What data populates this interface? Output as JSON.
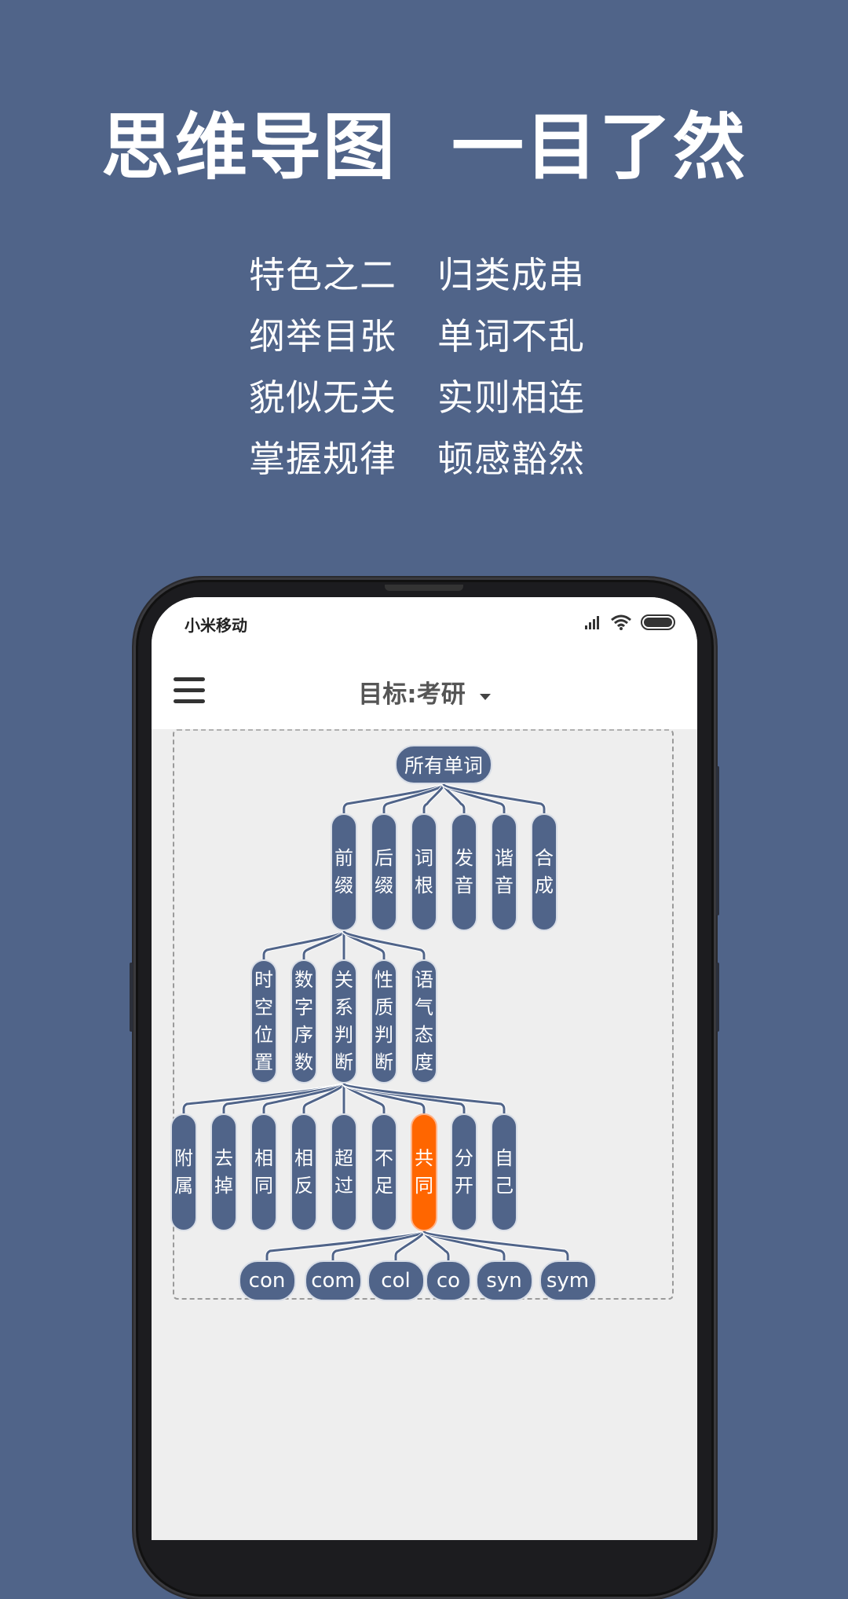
{
  "headline": {
    "part1": "思维导图",
    "part2": "一目了然"
  },
  "taglines": {
    "left": [
      "特色之二",
      "纲举目张",
      "貌似无关",
      "掌握规律"
    ],
    "right": [
      "归类成串",
      "单词不乱",
      "实则相连",
      "顿感豁然"
    ]
  },
  "status_bar": {
    "carrier": "小米移动",
    "icons": [
      "signal-icon",
      "wifi-icon",
      "battery-icon"
    ]
  },
  "app_bar": {
    "menu_icon": "hamburger-menu-icon",
    "title": "目标:考研",
    "dropdown_icon": "caret-down-icon"
  },
  "colors": {
    "background": "#506489",
    "node": "#506489",
    "node_active": "#ff6600",
    "canvas": "#eeeeee"
  },
  "mind_map": {
    "root": "所有单词",
    "level1": [
      "前缀",
      "后缀",
      "词根",
      "发音",
      "谐音",
      "合成"
    ],
    "level1_expanded": "前缀",
    "level2": [
      "时空位置",
      "数字序数",
      "关系判断",
      "性质判断",
      "语气态度"
    ],
    "level2_expanded": "关系判断",
    "level3": [
      "附属",
      "去掉",
      "相同",
      "相反",
      "超过",
      "不足",
      "共同",
      "分开",
      "自己"
    ],
    "level3_selected": "共同",
    "level4": [
      "con",
      "com",
      "col",
      "co",
      "syn",
      "sym"
    ]
  }
}
